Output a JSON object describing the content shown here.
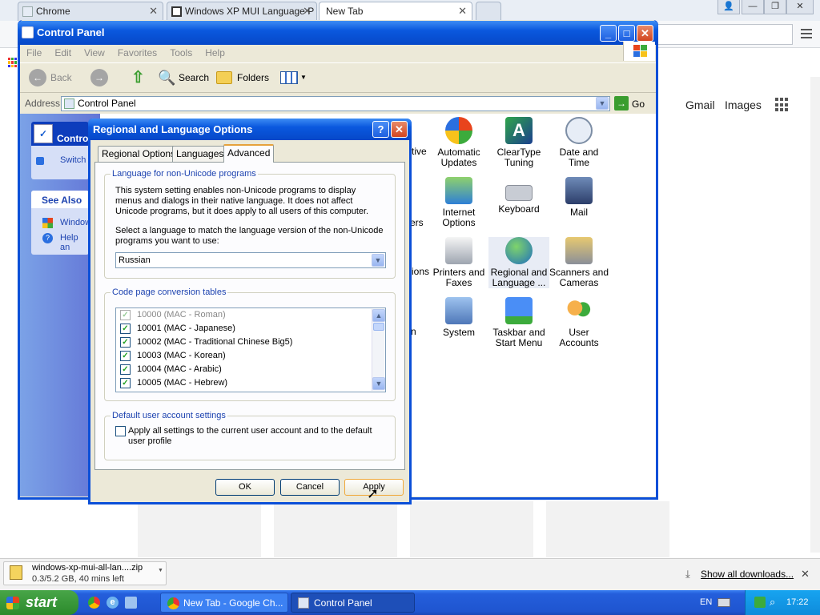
{
  "chrome": {
    "tabs": [
      {
        "label": "Chrome"
      },
      {
        "label": "Windows XP MUI Language P"
      },
      {
        "label": "New Tab"
      }
    ],
    "gmail": "Gmail",
    "images": "Images"
  },
  "cp": {
    "title": "Control Panel",
    "menu": [
      "File",
      "Edit",
      "View",
      "Favorites",
      "Tools",
      "Help"
    ],
    "toolbar": {
      "back": "Back",
      "search": "Search",
      "folders": "Folders"
    },
    "address_label": "Address",
    "address_value": "Control Panel",
    "go": "Go",
    "leftpane": {
      "title": "Contro",
      "switch": "Switch",
      "see_also": "See Also",
      "link1": "Window",
      "link2": "Help an"
    },
    "partials": [
      "tive",
      "ers",
      "ions",
      "n"
    ],
    "items": [
      {
        "label": "Automatic Updates"
      },
      {
        "label": "ClearType Tuning"
      },
      {
        "label": "Date and Time"
      },
      {
        "label": "Internet Options"
      },
      {
        "label": "Keyboard"
      },
      {
        "label": "Mail"
      },
      {
        "label": "Printers and Faxes"
      },
      {
        "label": "Regional and Language ..."
      },
      {
        "label": "Scanners and Cameras"
      },
      {
        "label": "System"
      },
      {
        "label": "Taskbar and Start Menu"
      },
      {
        "label": "User Accounts"
      }
    ]
  },
  "dialog": {
    "title": "Regional and Language Options",
    "tabs": [
      "Regional Options",
      "Languages",
      "Advanced"
    ],
    "group1_title": "Language for non-Unicode programs",
    "group1_desc": "This system setting enables non-Unicode programs to display menus and dialogs in their native language. It does not affect Unicode programs, but it does apply to all users of this computer.",
    "group1_prompt": "Select a language to match the language version of the non-Unicode programs you want to use:",
    "language": "Russian",
    "group2_title": "Code page conversion tables",
    "codepages": [
      "10000 (MAC - Roman)",
      "10001 (MAC - Japanese)",
      "10002 (MAC - Traditional Chinese Big5)",
      "10003 (MAC - Korean)",
      "10004 (MAC - Arabic)",
      "10005 (MAC - Hebrew)"
    ],
    "group3_title": "Default user account settings",
    "apply_all": "Apply all settings to the current user account and to the default user profile",
    "ok": "OK",
    "cancel": "Cancel",
    "apply": "Apply"
  },
  "download": {
    "filename": "windows-xp-mui-all-lan....zip",
    "status": "0.3/5.2 GB, 40 mins left",
    "show_all": "Show all downloads..."
  },
  "taskbar": {
    "start": "start",
    "task1": "New Tab - Google Ch...",
    "task2": "Control Panel",
    "lang": "EN",
    "time": "17:22"
  }
}
